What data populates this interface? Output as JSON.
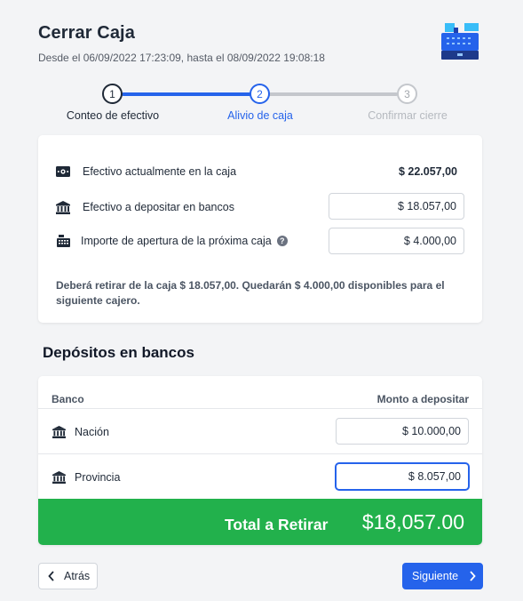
{
  "header": {
    "title": "Cerrar Caja",
    "subtitle": "Desde el 06/09/2022 17:23:09, hasta el 08/09/2022 19:08:18"
  },
  "stepper": {
    "steps": [
      {
        "number": "1",
        "label": "Conteo de efectivo",
        "state": "done"
      },
      {
        "number": "2",
        "label": "Alivio de caja",
        "state": "active"
      },
      {
        "number": "3",
        "label": "Confirmar cierre",
        "state": "pending"
      }
    ]
  },
  "summary": {
    "cash_in_register_label": "Efectivo actualmente en la caja",
    "cash_in_register_value": "$ 22.057,00",
    "deposit_label": "Efectivo a depositar en bancos",
    "deposit_value": "$ 18.057,00",
    "opening_label": "Importe de apertura de la próxima caja",
    "opening_value": "$ 4.000,00",
    "note": "Deberá retirar de la caja $ 18.057,00. Quedarán $ 4.000,00 disponibles para el siguiente cajero."
  },
  "deposits": {
    "title": "Depósitos en bancos",
    "col_bank": "Banco",
    "col_amount": "Monto a depositar",
    "rows": [
      {
        "bank": "Nación",
        "amount": "$ 10.000,00"
      },
      {
        "bank": "Provincia",
        "amount": "$ 8.057,00"
      }
    ],
    "total_label": "Total a Retirar",
    "total_value": "$18,057.00"
  },
  "footer": {
    "back_label": "Atrás",
    "next_label": "Siguiente"
  },
  "colors": {
    "accent": "#2563eb",
    "success": "#22b14c"
  }
}
